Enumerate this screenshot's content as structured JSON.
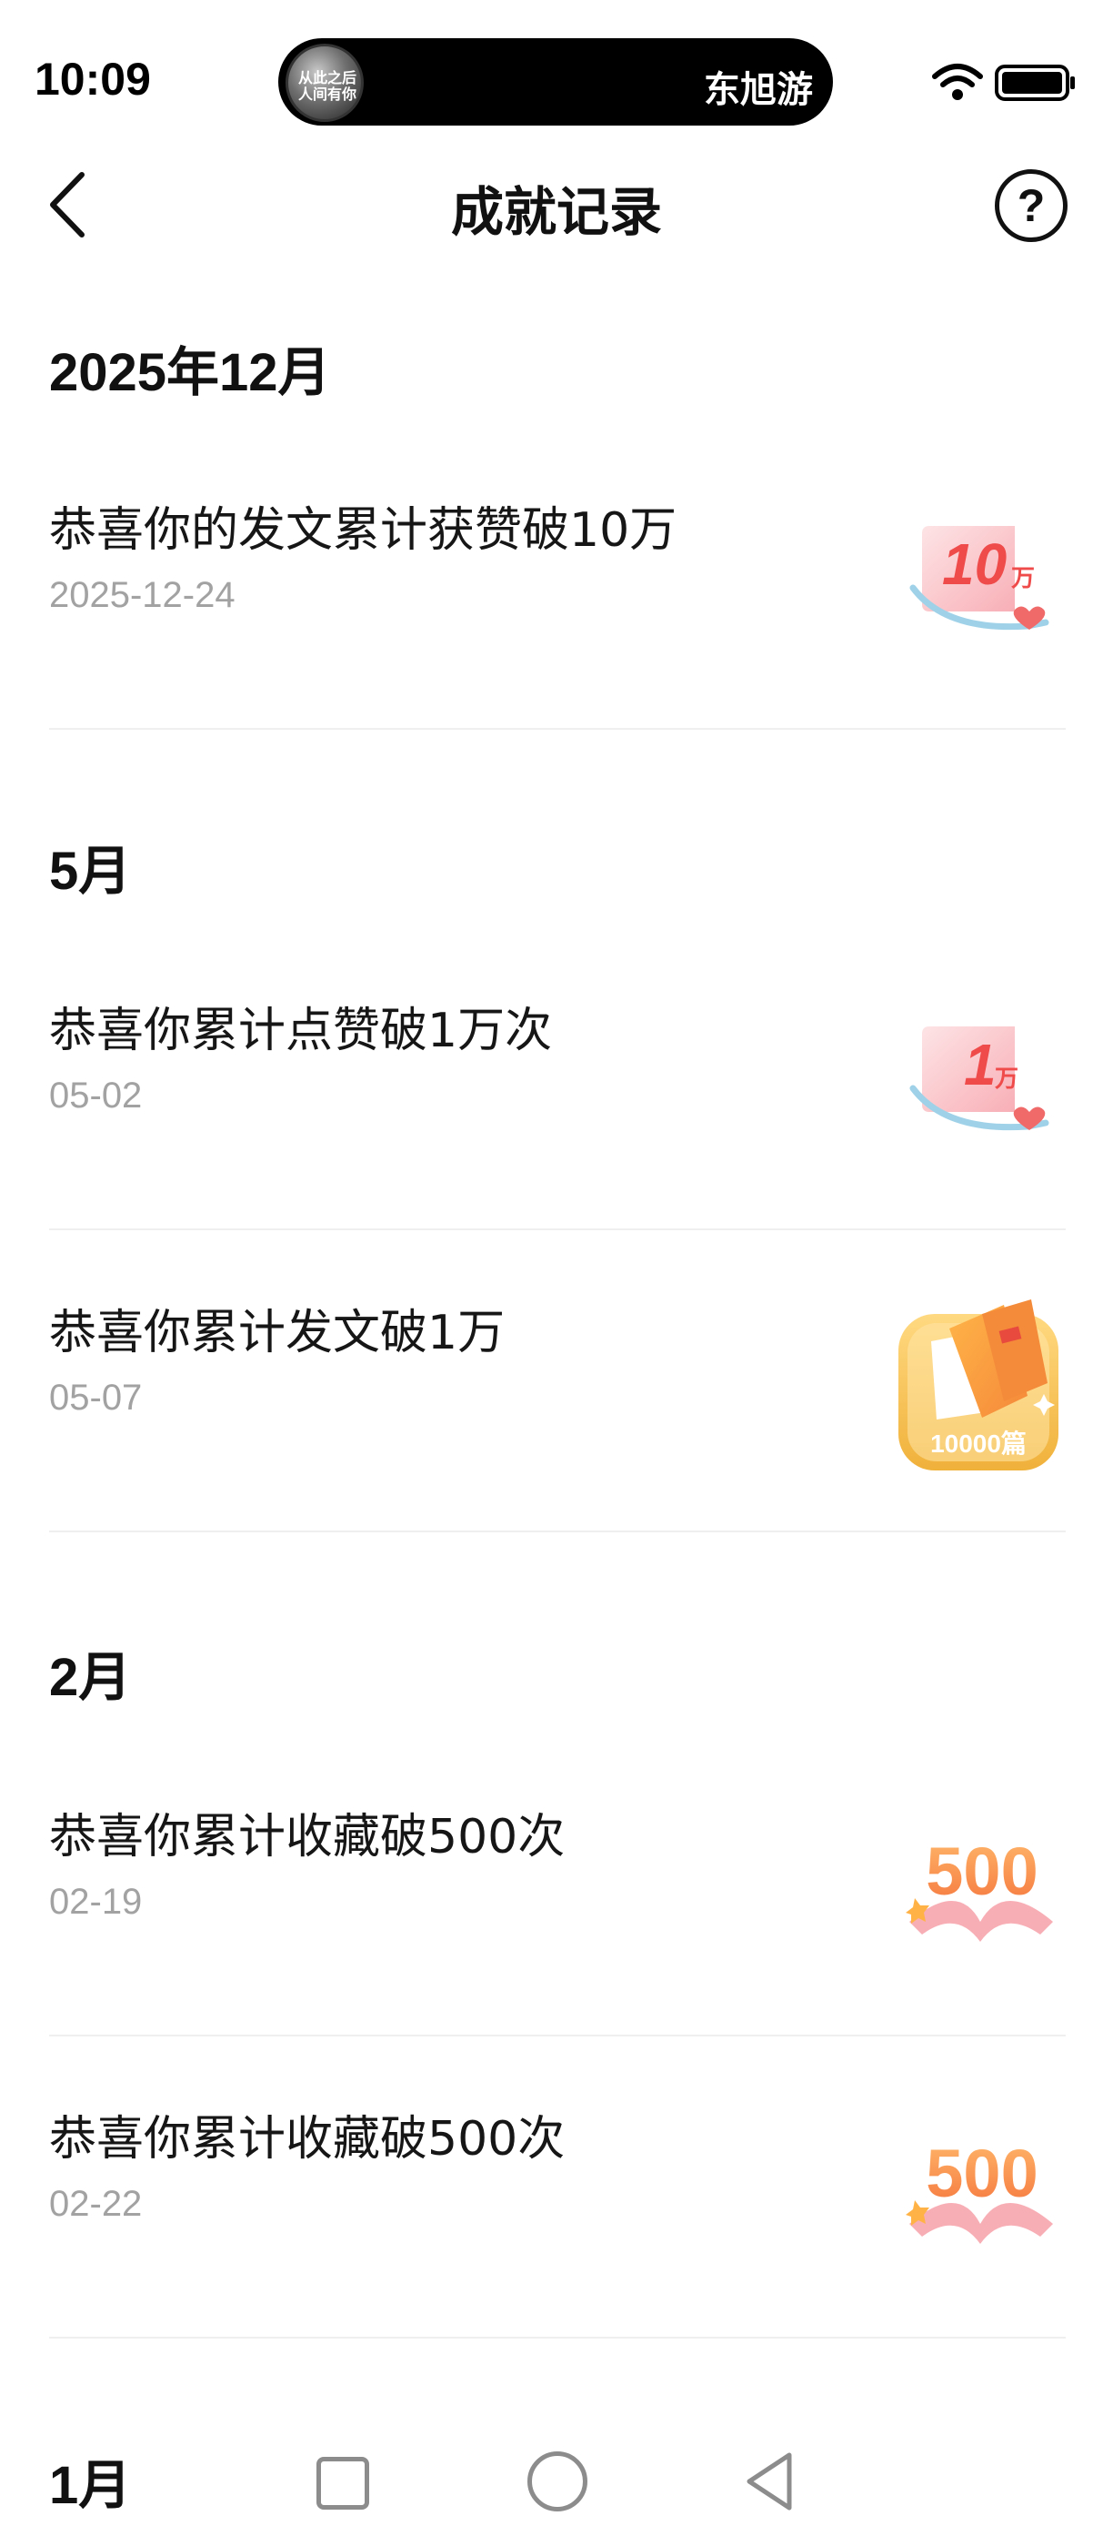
{
  "status_bar": {
    "time": "10:09",
    "island_avatar_text": "从此之后\n人间有你",
    "island_text": "东旭游",
    "wifi_icon": "wifi-icon",
    "battery_icon": "battery-icon"
  },
  "header": {
    "title": "成就记录",
    "back_icon": "back-arrow-icon",
    "help_icon": "help-icon",
    "help_glyph": "?"
  },
  "sections": [
    {
      "month": "2025年12月",
      "records": [
        {
          "title": "恭喜你的发文累计获赞破10万",
          "date": "2025-12-24",
          "badge": "likes-10wan-badge",
          "badge_label": "10",
          "badge_unit": "万"
        }
      ]
    },
    {
      "month": "5月",
      "records": [
        {
          "title": "恭喜你累计点赞破1万次",
          "date": "05-02",
          "badge": "likes-1wan-badge",
          "badge_label": "1",
          "badge_unit": "万"
        },
        {
          "title": "恭喜你累计发文破1万",
          "date": "05-07",
          "badge": "posts-10000-badge",
          "badge_label": "10000篇"
        }
      ]
    },
    {
      "month": "2月",
      "records": [
        {
          "title": "恭喜你累计收藏破500次",
          "date": "02-19",
          "badge": "favorites-500-badge",
          "badge_label": "500"
        },
        {
          "title": "恭喜你累计收藏破500次",
          "date": "02-22",
          "badge": "favorites-500-badge",
          "badge_label": "500"
        }
      ]
    },
    {
      "month": "1月",
      "records": []
    }
  ],
  "nav_bar": {
    "recent_apps": "recent-apps-icon",
    "home": "home-icon",
    "back": "back-triangle-icon"
  },
  "colors": {
    "badge_red": "#ef4b4b",
    "badge_pink": "#f6b9c0",
    "badge_gold": "#f4b63d",
    "badge_orange": "#f59a3c",
    "date_gray": "#a2a2a2",
    "divider": "#efefef"
  }
}
